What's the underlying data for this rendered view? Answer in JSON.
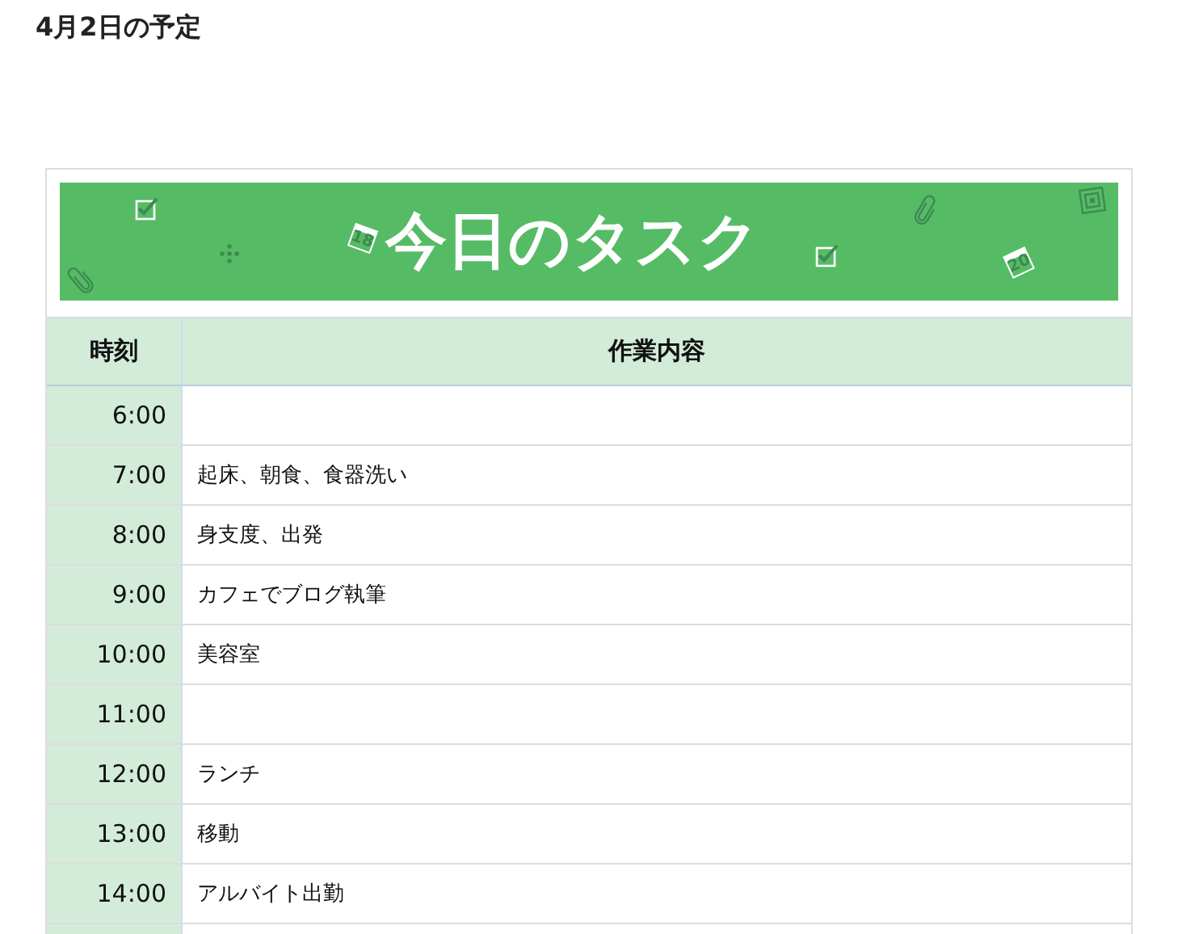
{
  "page_title": "4月2日の予定",
  "banner": {
    "title": "今日のタスク",
    "calendars": [
      "18",
      "20"
    ]
  },
  "table": {
    "columns": [
      "時刻",
      "作業内容"
    ],
    "rows": [
      {
        "time": "6:00"
      },
      {
        "time": "7:00",
        "task": "起床、朝食、食器洗い"
      },
      {
        "time": "8:00",
        "task": "身支度、出発"
      },
      {
        "time": "9:00",
        "task": "カフェでブログ執筆"
      },
      {
        "time": "10:00",
        "task": "美容室"
      },
      {
        "time": "11:00"
      },
      {
        "time": "12:00",
        "task": "ランチ"
      },
      {
        "time": "13:00",
        "task": "移動"
      },
      {
        "time": "14:00",
        "task": "アルバイト出勤"
      }
    ]
  }
}
